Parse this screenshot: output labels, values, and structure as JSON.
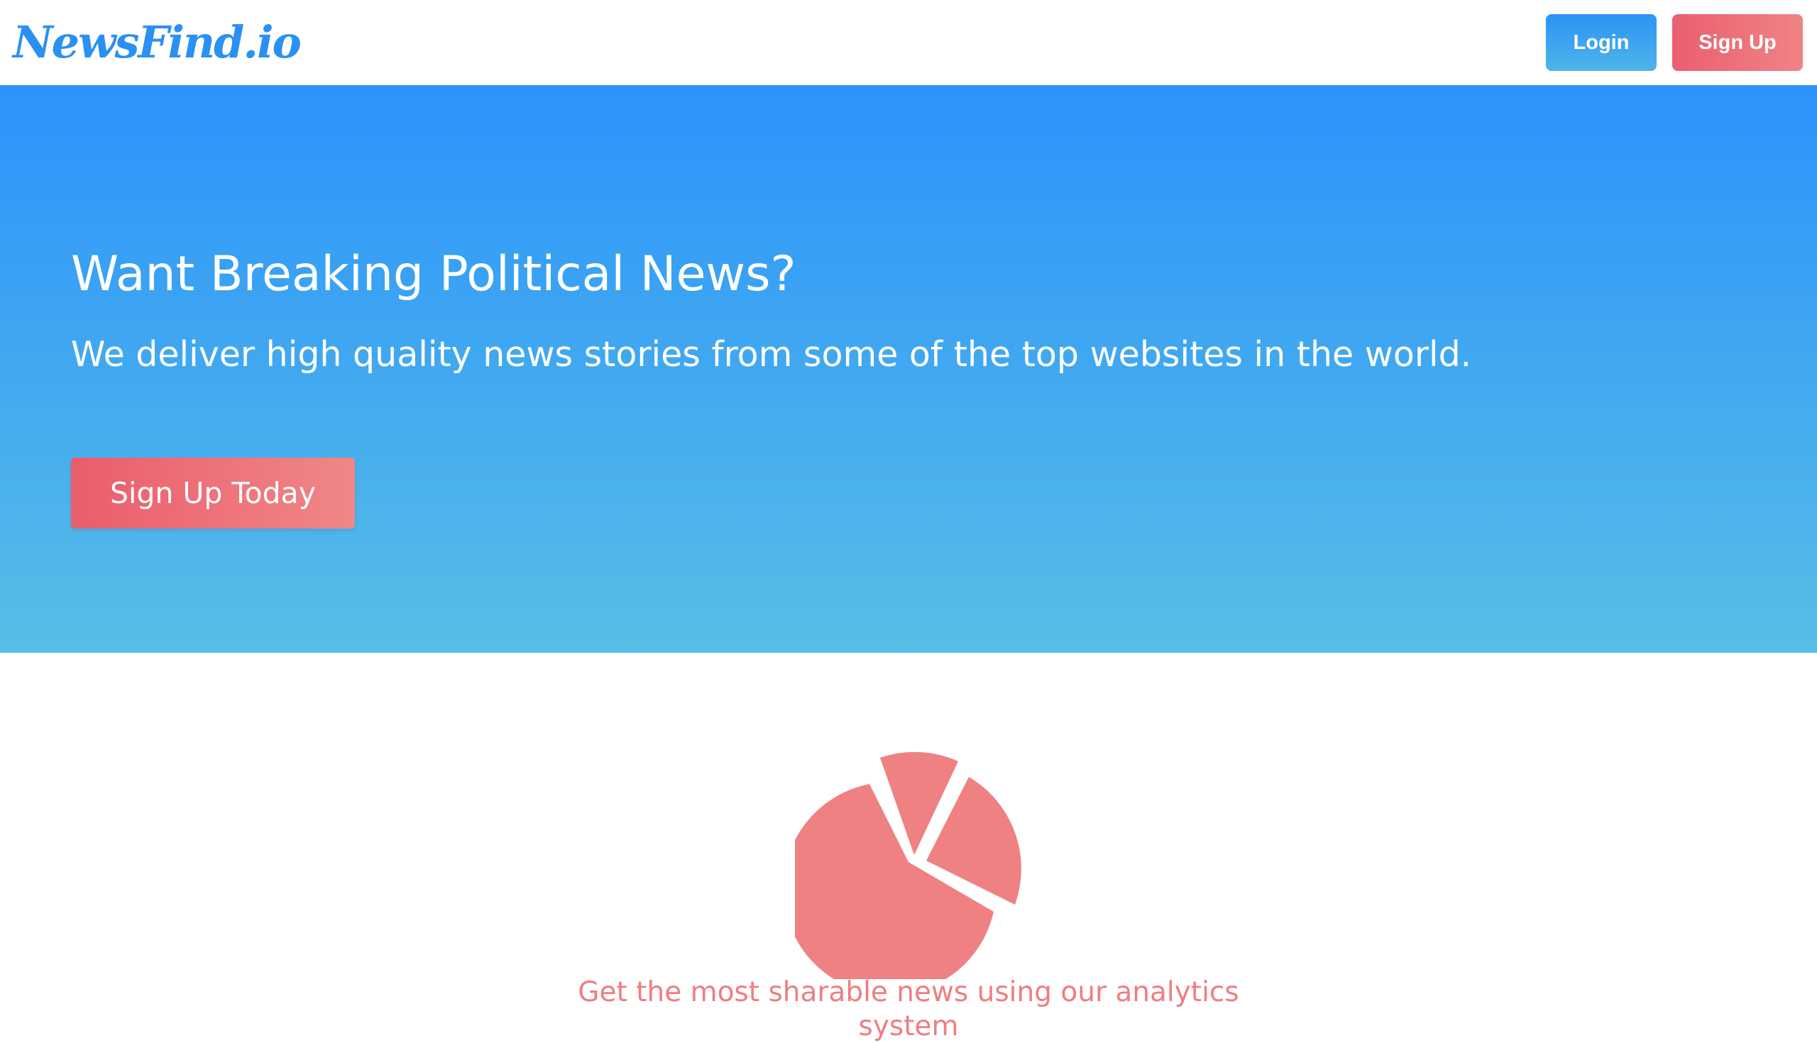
{
  "header": {
    "logo": "NewsFind.io",
    "login_label": "Login",
    "signup_label": "Sign Up"
  },
  "hero": {
    "title": "Want Breaking Political News?",
    "subtitle": "We deliver high quality news stories from some of the top websites in the world.",
    "cta_label": "Sign Up Today"
  },
  "feature": {
    "icon": "pie-chart-icon",
    "text": "Get the most sharable news using our analytics system"
  },
  "colors": {
    "brand_blue": "#2b90f3",
    "hero_gradient_top": "#2b93fb",
    "hero_gradient_bottom": "#57bee6",
    "accent_pink": "#ef7e80"
  }
}
